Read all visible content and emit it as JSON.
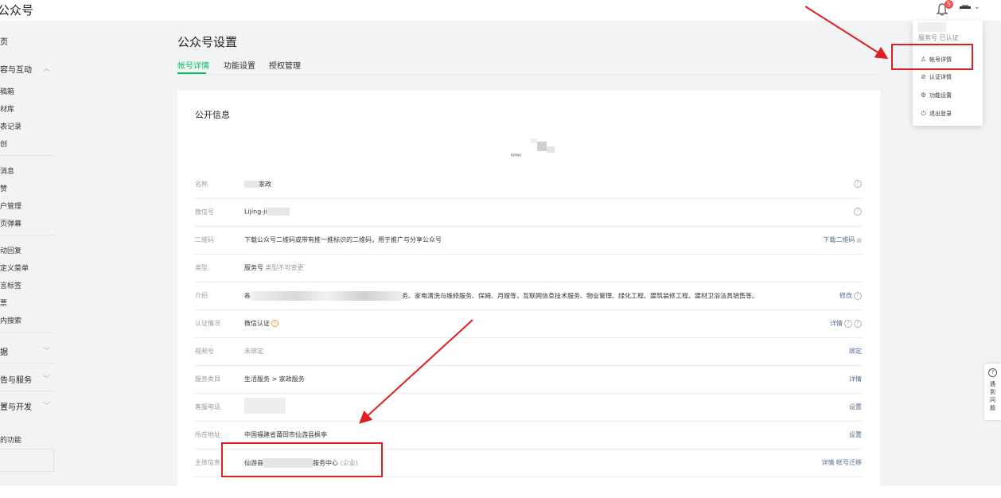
{
  "app_title": "公众号",
  "header": {
    "notification_count": "5"
  },
  "sidebar": {
    "items": [
      {
        "label": "页"
      },
      {
        "label": "容与互动"
      },
      {
        "label": "稿箱"
      },
      {
        "label": "材库"
      },
      {
        "label": "表记录"
      },
      {
        "label": "创"
      },
      {
        "label": "消息"
      },
      {
        "label": "赞"
      },
      {
        "label": "户管理"
      },
      {
        "label": "页弹幕"
      },
      {
        "label": "动回复"
      },
      {
        "label": "定义菜单"
      },
      {
        "label": "言标签"
      },
      {
        "label": "票"
      },
      {
        "label": "内搜索"
      },
      {
        "label": "据"
      },
      {
        "label": "告与服务"
      },
      {
        "label": "置与开发"
      },
      {
        "label": "的功能"
      }
    ]
  },
  "page": {
    "title": "公众号设置",
    "tabs": [
      "帐号详情",
      "功能设置",
      "授权管理"
    ],
    "active_tab": "帐号详情"
  },
  "public_info": {
    "title": "公开信息",
    "logo_text": "Lijing-j",
    "rows": [
      {
        "label": "名称",
        "value": "家政",
        "action": "",
        "help": true
      },
      {
        "label": "微信号",
        "value": "Lijing-ji",
        "action": "",
        "help": true
      },
      {
        "label": "二维码",
        "value": "下载公众号二维码或带有推一推标识的二维码，用于推广与分享公众号",
        "action": "下载二维码"
      },
      {
        "label": "类型",
        "value": "服务号",
        "value_note": "类型不可变更",
        "action": ""
      },
      {
        "label": "介绍",
        "value": "各",
        "value_tail": "务、家电清洗与维修服务、保姆、月嫂等，互联网信息技术服务、物业管理、绿化工程、建筑装修工程、建材卫浴洁具销售等。",
        "action": "修改"
      },
      {
        "label": "认证情况",
        "value": "微信认证",
        "action": "详情"
      },
      {
        "label": "视频号",
        "value": "未绑定",
        "action": "绑定"
      },
      {
        "label": "服务类目",
        "value": "生活服务 > 家政服务",
        "action": "详情"
      },
      {
        "label": "客服电话",
        "value": "",
        "action": "设置"
      },
      {
        "label": "所在地址",
        "value": "中国福建省莆田市仙游县枫亭",
        "action": "设置"
      },
      {
        "label": "主体信息",
        "value": "仙游县",
        "value_tail": "服务中心",
        "value_note": "(企业)",
        "action": "详情  帐号迁移"
      }
    ]
  },
  "dropdown": {
    "header": "服务号  已认证",
    "items": [
      {
        "label": "帐号详情",
        "icon": "user-icon"
      },
      {
        "label": "认证详情",
        "icon": "check-circle-icon"
      },
      {
        "label": "功能设置",
        "icon": "gear-icon"
      },
      {
        "label": "退出登录",
        "icon": "power-icon"
      }
    ]
  },
  "float_button": {
    "label": "遇到问题"
  },
  "colors": {
    "accent": "#07c160",
    "link": "#576b95",
    "annotation": "#e02020",
    "background": "#f2f3f5"
  }
}
